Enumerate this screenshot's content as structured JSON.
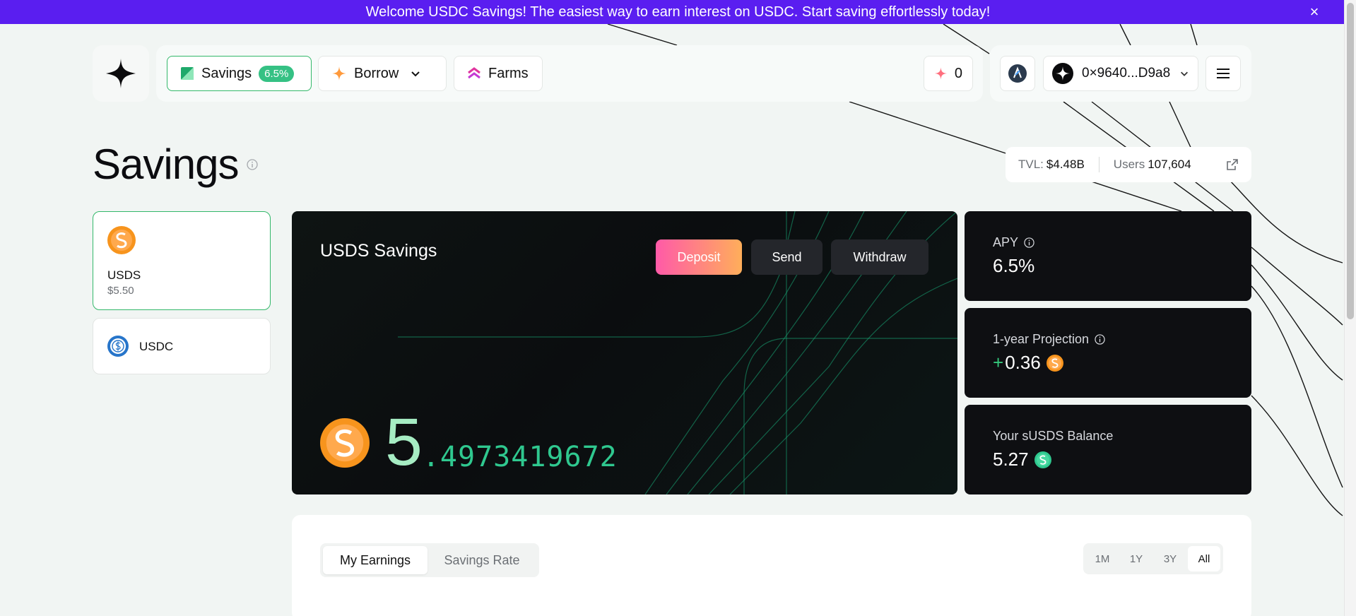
{
  "banner": {
    "text": "Welcome USDC Savings! The easiest way to earn interest on USDC. Start saving effortlessly today!",
    "close": "×"
  },
  "nav": {
    "savings_label": "Savings",
    "savings_apy": "6.5%",
    "borrow_label": "Borrow",
    "farms_label": "Farms",
    "points": "0",
    "wallet_address": "0×9640...D9a8"
  },
  "page": {
    "title": "Savings"
  },
  "stats": {
    "tvl_label": "TVL:",
    "tvl_value": "$4.48B",
    "users_label": "Users",
    "users_value": "107,604"
  },
  "tokens": [
    {
      "symbol": "USDS",
      "value": "$5.50",
      "selected": true
    },
    {
      "symbol": "USDC",
      "selected": false
    }
  ],
  "savings_card": {
    "title": "USDS Savings",
    "deposit_label": "Deposit",
    "send_label": "Send",
    "withdraw_label": "Withdraw",
    "balance_int": "5",
    "balance_frac": ".4973419672"
  },
  "apy_card": {
    "label": "APY",
    "value": "6.5%"
  },
  "projection_card": {
    "label": "1-year Projection",
    "sign": "+",
    "value": "0.36"
  },
  "susds_card": {
    "label": "Your sUSDS Balance",
    "value": "5.27"
  },
  "chart_tabs": {
    "earnings": "My Earnings",
    "rate": "Savings Rate"
  },
  "ranges": [
    "1M",
    "1Y",
    "3Y",
    "All"
  ],
  "colors": {
    "banner": "#5a1ef0",
    "accent_green": "#33b86a",
    "balance_green": "#2fc88f",
    "usds_orange": "#f7941d",
    "usdc_blue": "#2775ca"
  }
}
